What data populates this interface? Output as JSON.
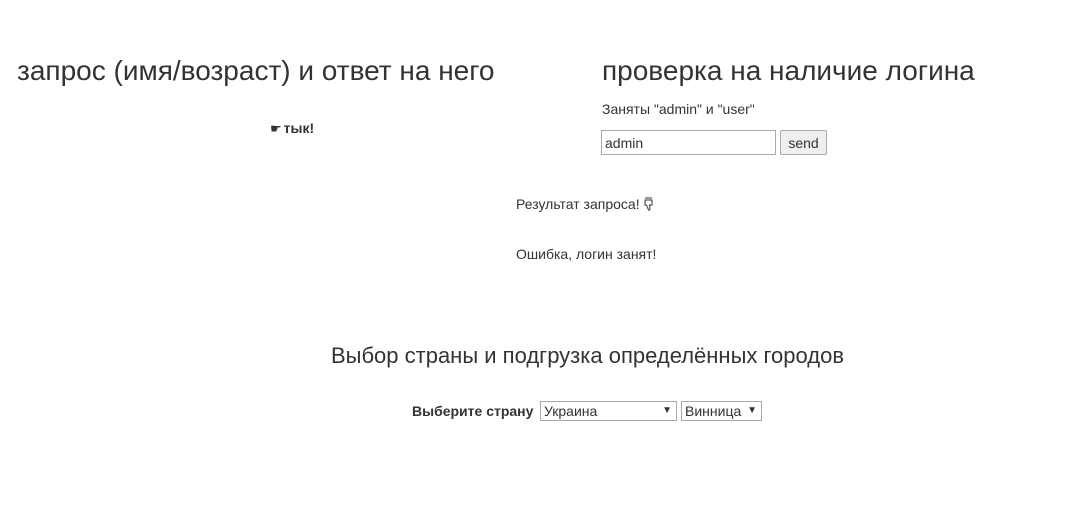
{
  "left_section": {
    "title": "запрос (имя/возраст) и ответ на него",
    "action_icon": "pointing-hand-icon",
    "action_label": "тык!"
  },
  "login_check": {
    "title": "проверка на наличие логина",
    "note": "Заняты \"admin\" и \"user\"",
    "input_value": "admin",
    "send_label": "send",
    "result_title": "Результат запроса!",
    "result_icon": "thumbs-down-icon",
    "result_message": "Ошибка, логин занят!"
  },
  "country_section": {
    "title": "Выбор страны и подгрузка определённых городов",
    "label": "Выберите страну",
    "country_selected": "Украина",
    "city_selected": "Винница"
  }
}
